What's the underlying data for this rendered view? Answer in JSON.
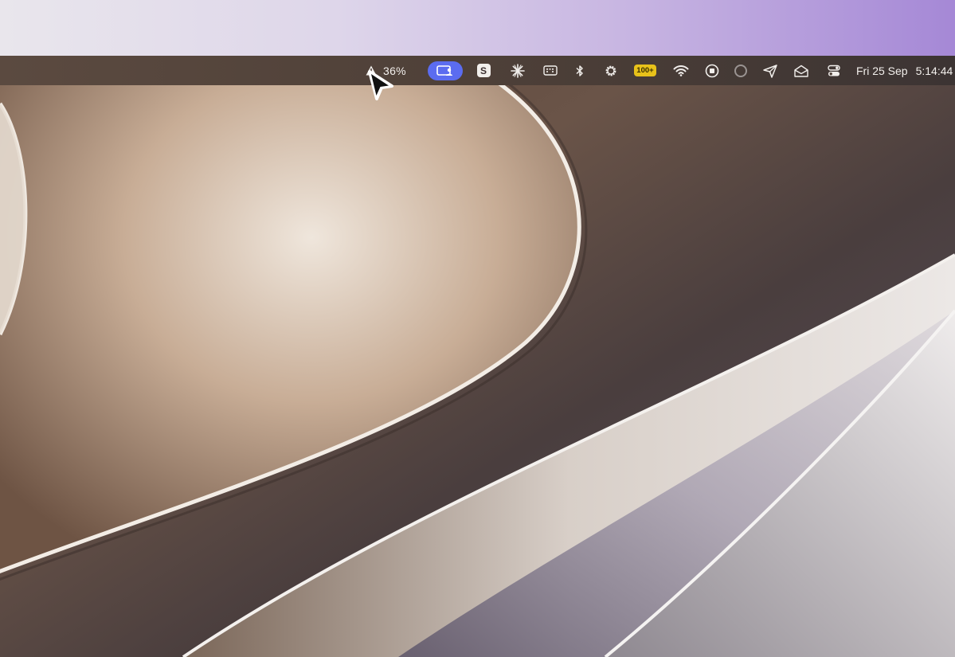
{
  "menubar": {
    "battery_percent": "36%",
    "s_app_letter": "S",
    "battery_badge": "100+",
    "date": "Fri 25 Sep",
    "time": "5:14:44"
  },
  "icons": [
    "warning-icon",
    "screen-share-icon",
    "s-app-icon",
    "sparkle-icon",
    "keyboard-icon",
    "bluetooth-icon",
    "gear-icon",
    "battery-badge-icon",
    "wifi-icon",
    "record-stop-icon",
    "circle-icon",
    "send-icon",
    "mail-icon",
    "control-center-icon",
    "mouse-pointer-icon"
  ],
  "colors": {
    "menubar_bg": "#4e4038",
    "accent_pill": "#5b6cf0",
    "badge_yellow": "#e8c21a"
  }
}
